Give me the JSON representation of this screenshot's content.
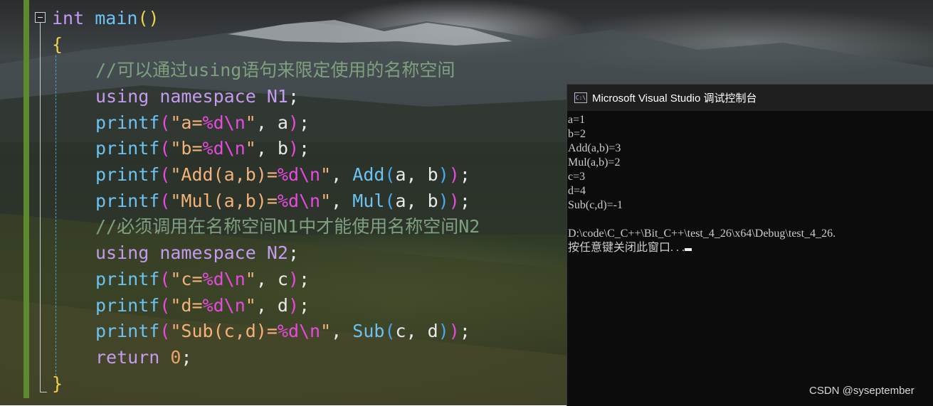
{
  "editor": {
    "lines": [
      [
        {
          "t": "int",
          "c": "kw"
        },
        {
          "t": " ",
          "c": "punc"
        },
        {
          "t": "main",
          "c": "fn"
        },
        {
          "t": "()",
          "c": "paren"
        }
      ],
      [
        {
          "t": "{",
          "c": "brace"
        }
      ],
      [
        {
          "t": "//可以通过using语句来限定使用的名称空间",
          "c": "cmt"
        }
      ],
      [
        {
          "t": "using",
          "c": "kw"
        },
        {
          "t": " ",
          "c": "punc"
        },
        {
          "t": "namespace",
          "c": "kw"
        },
        {
          "t": " ",
          "c": "punc"
        },
        {
          "t": "N1",
          "c": "ns"
        },
        {
          "t": ";",
          "c": "punc"
        }
      ],
      [
        {
          "t": "printf",
          "c": "fn"
        },
        {
          "t": "(",
          "c": "paren2"
        },
        {
          "t": "\"a=",
          "c": "str"
        },
        {
          "t": "%d",
          "c": "esc"
        },
        {
          "t": "\\n",
          "c": "esc"
        },
        {
          "t": "\"",
          "c": "str"
        },
        {
          "t": ", ",
          "c": "punc"
        },
        {
          "t": "a",
          "c": "ident"
        },
        {
          "t": ")",
          "c": "paren2"
        },
        {
          "t": ";",
          "c": "punc"
        }
      ],
      [
        {
          "t": "printf",
          "c": "fn"
        },
        {
          "t": "(",
          "c": "paren2"
        },
        {
          "t": "\"b=",
          "c": "str"
        },
        {
          "t": "%d",
          "c": "esc"
        },
        {
          "t": "\\n",
          "c": "esc"
        },
        {
          "t": "\"",
          "c": "str"
        },
        {
          "t": ", ",
          "c": "punc"
        },
        {
          "t": "b",
          "c": "ident"
        },
        {
          "t": ")",
          "c": "paren2"
        },
        {
          "t": ";",
          "c": "punc"
        }
      ],
      [
        {
          "t": "printf",
          "c": "fn"
        },
        {
          "t": "(",
          "c": "paren2"
        },
        {
          "t": "\"Add(a,b)=",
          "c": "str"
        },
        {
          "t": "%d",
          "c": "esc"
        },
        {
          "t": "\\n",
          "c": "esc"
        },
        {
          "t": "\"",
          "c": "str"
        },
        {
          "t": ", ",
          "c": "punc"
        },
        {
          "t": "Add",
          "c": "fn"
        },
        {
          "t": "(",
          "c": "paren3"
        },
        {
          "t": "a, b",
          "c": "ident"
        },
        {
          "t": ")",
          "c": "paren3"
        },
        {
          "t": ")",
          "c": "paren2"
        },
        {
          "t": ";",
          "c": "punc"
        }
      ],
      [
        {
          "t": "printf",
          "c": "fn"
        },
        {
          "t": "(",
          "c": "paren2"
        },
        {
          "t": "\"Mul(a,b)=",
          "c": "str"
        },
        {
          "t": "%d",
          "c": "esc"
        },
        {
          "t": "\\n",
          "c": "esc"
        },
        {
          "t": "\"",
          "c": "str"
        },
        {
          "t": ", ",
          "c": "punc"
        },
        {
          "t": "Mul",
          "c": "fn"
        },
        {
          "t": "(",
          "c": "paren3"
        },
        {
          "t": "a, b",
          "c": "ident"
        },
        {
          "t": ")",
          "c": "paren3"
        },
        {
          "t": ")",
          "c": "paren2"
        },
        {
          "t": ";",
          "c": "punc"
        }
      ],
      [
        {
          "t": "//必须调用在名称空间N1中才能使用名称空间N2",
          "c": "cmt"
        }
      ],
      [
        {
          "t": "using",
          "c": "kw"
        },
        {
          "t": " ",
          "c": "punc"
        },
        {
          "t": "namespace",
          "c": "kw"
        },
        {
          "t": " ",
          "c": "punc"
        },
        {
          "t": "N2",
          "c": "ns"
        },
        {
          "t": ";",
          "c": "punc"
        }
      ],
      [
        {
          "t": "printf",
          "c": "fn"
        },
        {
          "t": "(",
          "c": "paren2"
        },
        {
          "t": "\"c=",
          "c": "str"
        },
        {
          "t": "%d",
          "c": "esc"
        },
        {
          "t": "\\n",
          "c": "esc"
        },
        {
          "t": "\"",
          "c": "str"
        },
        {
          "t": ", ",
          "c": "punc"
        },
        {
          "t": "c",
          "c": "ident"
        },
        {
          "t": ")",
          "c": "paren2"
        },
        {
          "t": ";",
          "c": "punc"
        }
      ],
      [
        {
          "t": "printf",
          "c": "fn"
        },
        {
          "t": "(",
          "c": "paren2"
        },
        {
          "t": "\"d=",
          "c": "str"
        },
        {
          "t": "%d",
          "c": "esc"
        },
        {
          "t": "\\n",
          "c": "esc"
        },
        {
          "t": "\"",
          "c": "str"
        },
        {
          "t": ", ",
          "c": "punc"
        },
        {
          "t": "d",
          "c": "ident"
        },
        {
          "t": ")",
          "c": "paren2"
        },
        {
          "t": ";",
          "c": "punc"
        }
      ],
      [
        {
          "t": "printf",
          "c": "fn"
        },
        {
          "t": "(",
          "c": "paren2"
        },
        {
          "t": "\"Sub(c,d)=",
          "c": "str"
        },
        {
          "t": "%d",
          "c": "esc"
        },
        {
          "t": "\\n",
          "c": "esc"
        },
        {
          "t": "\"",
          "c": "str"
        },
        {
          "t": ", ",
          "c": "punc"
        },
        {
          "t": "Sub",
          "c": "fn"
        },
        {
          "t": "(",
          "c": "paren3"
        },
        {
          "t": "c, d",
          "c": "ident"
        },
        {
          "t": ")",
          "c": "paren3"
        },
        {
          "t": ")",
          "c": "paren2"
        },
        {
          "t": ";",
          "c": "punc"
        }
      ],
      [
        {
          "t": "return",
          "c": "kw"
        },
        {
          "t": " ",
          "c": "punc"
        },
        {
          "t": "0",
          "c": "num"
        },
        {
          "t": ";",
          "c": "punc"
        }
      ],
      [
        {
          "t": "}",
          "c": "brace"
        }
      ]
    ]
  },
  "console": {
    "icon": "vs-console-icon",
    "icon_text": "C:\\",
    "title": "Microsoft Visual Studio 调试控制台",
    "output": [
      "a=1",
      "b=2",
      "Add(a,b)=3",
      "Mul(a,b)=2",
      "c=3",
      "d=4",
      "Sub(c,d)=-1",
      "",
      "D:\\code\\C_C++\\Bit_C++\\test_4_26\\x64\\Debug\\test_4_26.",
      "按任意键关闭此窗口. . ."
    ]
  },
  "watermark": "CSDN @syseptember"
}
